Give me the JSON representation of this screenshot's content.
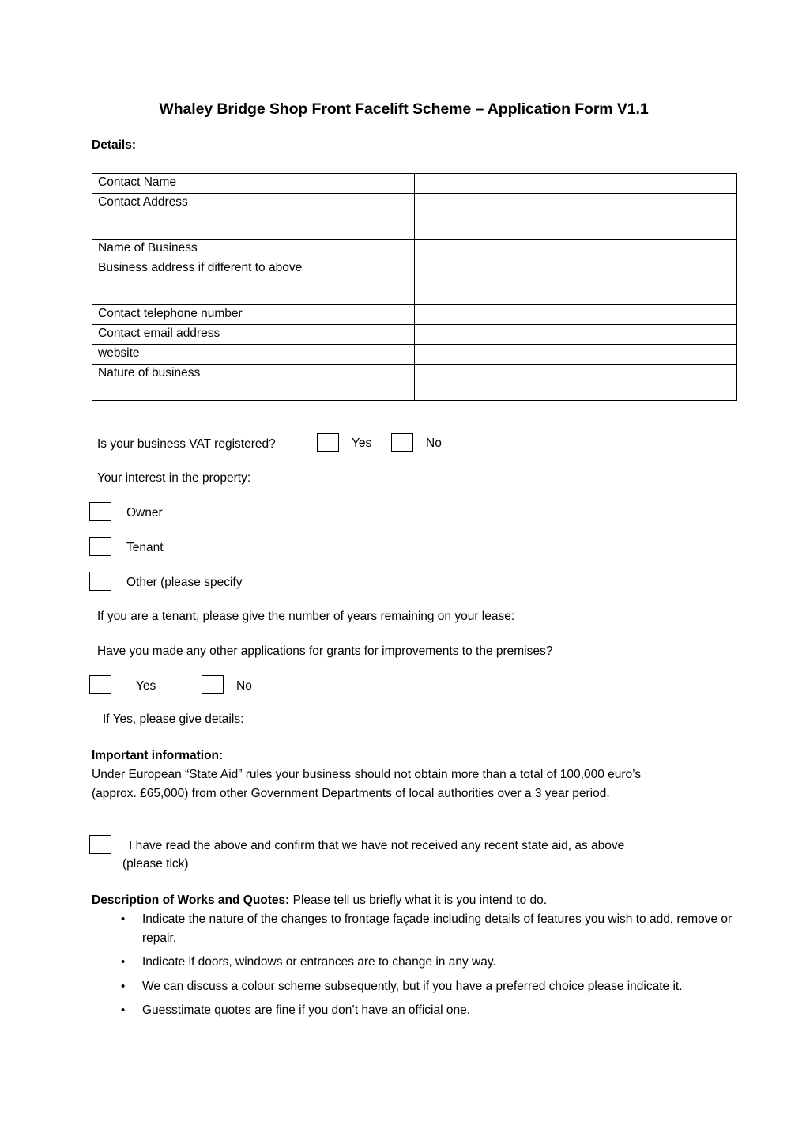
{
  "document": {
    "title": "Whaley Bridge Shop Front Facelift Scheme – Application Form V1.1",
    "section_label": "Details:"
  },
  "details_table": {
    "rows": [
      {
        "label": "Contact Name",
        "value": "",
        "size": "short"
      },
      {
        "label": "Contact Address",
        "value": "",
        "size": "tall"
      },
      {
        "label": "Name of Business",
        "value": "",
        "size": "short"
      },
      {
        "label": "Business address if different to above",
        "value": "",
        "size": "tall"
      },
      {
        "label": "Contact telephone number",
        "value": "",
        "size": "short"
      },
      {
        "label": "Contact email address",
        "value": "",
        "size": "short"
      },
      {
        "label": "website",
        "value": "",
        "size": "short"
      },
      {
        "label": "Nature of business",
        "value": "",
        "size": "mid"
      }
    ]
  },
  "vat": {
    "question": "Is your business VAT registered?",
    "yes_label": "Yes",
    "no_label": "No"
  },
  "interest": {
    "heading": "Your interest in the property:",
    "options": [
      {
        "label": "Owner"
      },
      {
        "label": "Tenant"
      },
      {
        "label": "Other (please specify"
      }
    ]
  },
  "lease": {
    "question": "If you are a tenant, please give the number of years remaining on your lease:"
  },
  "grants": {
    "question": "Have you made any other applications for grants for improvements to the premises?",
    "yes_label": "Yes",
    "no_label": "No",
    "followup": "If Yes, please give details:"
  },
  "important_information": {
    "heading": "Important information:",
    "body": "Under European “State Aid” rules your business should not obtain more than a total of 100,000 euro’s (approx. £65,000) from other Government Departments of local authorities over a 3 year period."
  },
  "state_aid_confirm": {
    "line1": "I have read the above and confirm that we have not received any recent state aid, as above",
    "line2": "(please tick)"
  },
  "works": {
    "heading_bold": "Description of Works and Quotes:",
    "heading_rest": " Please tell us briefly what it is you intend to do.",
    "bullets": [
      "Indicate the nature of the changes to frontage façade including details of features you wish to add, remove or repair.",
      "Indicate  if doors, windows or entrances are to change in any way.",
      "We can discuss a colour scheme subsequently, but if you have a preferred choice please indicate it.",
      "Guesstimate quotes are fine if you don’t have an official one."
    ]
  },
  "colors": {
    "text": "#000000",
    "page_background": "#ffffff",
    "border": "#000000"
  }
}
